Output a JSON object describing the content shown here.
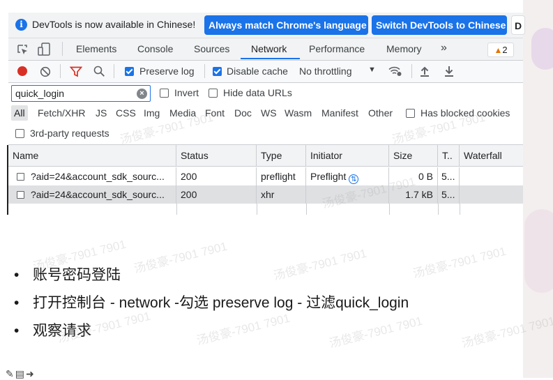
{
  "infobar": {
    "message": "DevTools is now available in Chinese!",
    "btn_match": "Always match Chrome's language",
    "btn_switch": "Switch DevTools to Chinese",
    "btn_dont": "D"
  },
  "tabs": {
    "items": [
      "Elements",
      "Console",
      "Sources",
      "Network",
      "Performance",
      "Memory"
    ],
    "active": "Network",
    "more": "»",
    "warnings": "2"
  },
  "toolbar": {
    "preserve_log": "Preserve log",
    "preserve_log_checked": true,
    "disable_cache": "Disable cache",
    "disable_cache_checked": true,
    "throttling": "No throttling"
  },
  "filter": {
    "value": "quick_login",
    "invert": "Invert",
    "hide_data_urls": "Hide data URLs"
  },
  "types": [
    "All",
    "Fetch/XHR",
    "JS",
    "CSS",
    "Img",
    "Media",
    "Font",
    "Doc",
    "WS",
    "Wasm",
    "Manifest",
    "Other"
  ],
  "blocked_cookies": "Has blocked cookies",
  "third_party": "3rd-party requests",
  "table": {
    "headers": [
      "Name",
      "Status",
      "Type",
      "Initiator",
      "Size",
      "T..",
      "Waterfall"
    ],
    "rows": [
      {
        "name": "?aid=24&account_sdk_sourc...",
        "status": "200",
        "type": "preflight",
        "initiator": "Preflight",
        "size": "0 B",
        "time": "5..."
      },
      {
        "name": "?aid=24&account_sdk_sourc...",
        "status": "200",
        "type": "xhr",
        "initiator": "",
        "size": "1.7 kB",
        "time": "5..."
      }
    ]
  },
  "slide": {
    "bullets": [
      "账号密码登陆",
      "打开控制台 - network -勾选 preserve log - 过滤quick_login",
      "观察请求"
    ]
  },
  "watermark": "汤俊豪-7901 7901"
}
